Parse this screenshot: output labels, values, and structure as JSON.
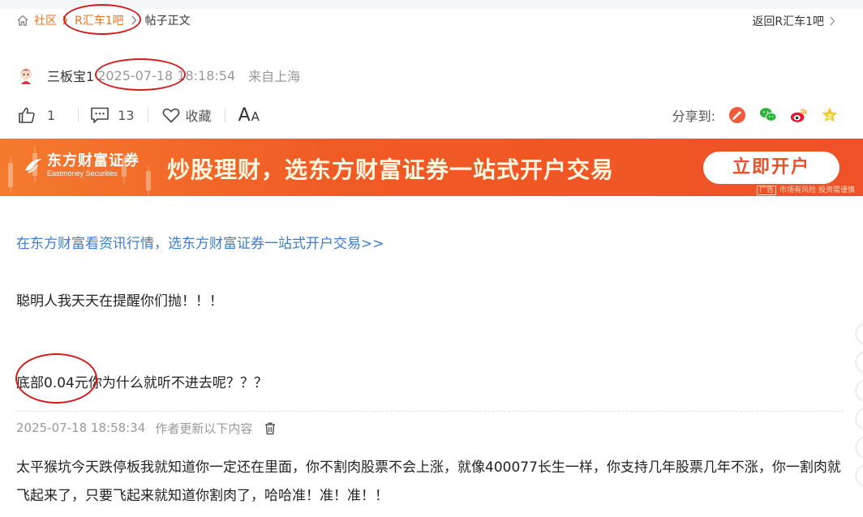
{
  "breadcrumb": {
    "community": "社区",
    "bar": "R汇车1吧",
    "current": "帖子正文"
  },
  "back_link": "返回R汇车1吧",
  "post": {
    "author": "三板宝1",
    "timestamp": "2025-07-18 18:18:54",
    "location": "来自上海"
  },
  "actions": {
    "like_count": "1",
    "comment_count": "13",
    "favorite_label": "收藏",
    "font_big": "A",
    "font_small": "A",
    "share_label": "分享到:"
  },
  "banner": {
    "logo_cn": "东方财富证券",
    "logo_en": "Eastmoney Securities",
    "slogan": "炒股理财，选东方财富证券一站式开户交易",
    "cta": "立即开户",
    "ad_tag": "广告",
    "disclaimer": "市场有风险 投资需谨慎"
  },
  "content": {
    "promo_link": "在东方财富看资讯行情，选东方财富证券一站式开户交易>>",
    "line1": "聪明人我天天在提醒你们抛！！！",
    "line2": "底部0.04元你为什么就听不进去呢？？？"
  },
  "update": {
    "timestamp": "2025-07-18 18:58:34",
    "note": "作者更新以下内容",
    "body": "太平猴坑今天跌停板我就知道你一定还在里面，你不割肉股票不会上涨，就像400077长生一样，你支持几年股票几年不涨，你一割肉就飞起来了，只要飞起来就知道你割肉了，哈哈准！准！准！！"
  },
  "colors": {
    "accent_orange": "#e8731f",
    "link_blue": "#3a7dd0",
    "annotation_red": "#d61a1a",
    "banner_orange": "#f05a25"
  },
  "icons": [
    "home-icon",
    "chevron-right-icon",
    "thumbs-up-icon",
    "comment-icon",
    "heart-icon",
    "trash-icon",
    "toutiao-share-icon",
    "wechat-share-icon",
    "weibo-share-icon",
    "favorite-star-share-icon"
  ]
}
